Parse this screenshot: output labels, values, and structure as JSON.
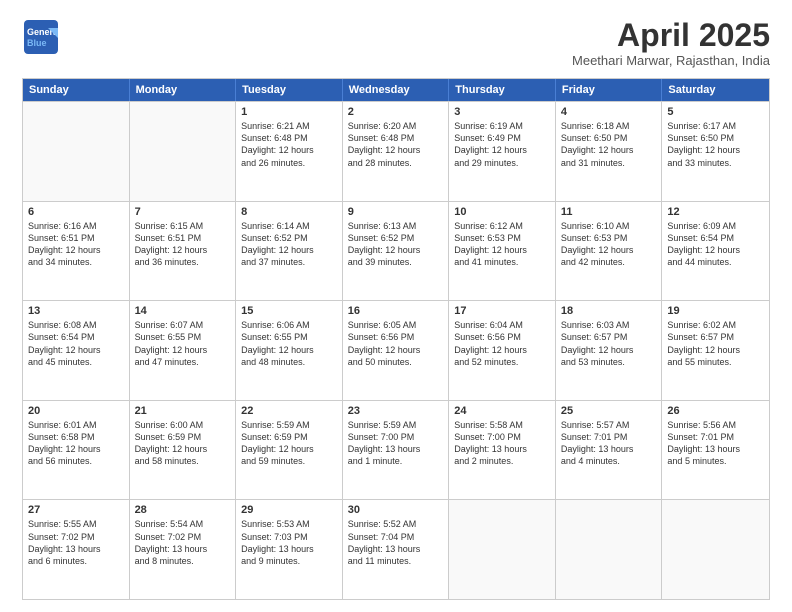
{
  "header": {
    "logo_line1": "General",
    "logo_line2": "Blue",
    "month": "April 2025",
    "location": "Meethari Marwar, Rajasthan, India"
  },
  "days_of_week": [
    "Sunday",
    "Monday",
    "Tuesday",
    "Wednesday",
    "Thursday",
    "Friday",
    "Saturday"
  ],
  "weeks": [
    [
      {
        "day": "",
        "empty": true,
        "lines": []
      },
      {
        "day": "",
        "empty": true,
        "lines": []
      },
      {
        "day": "1",
        "empty": false,
        "lines": [
          "Sunrise: 6:21 AM",
          "Sunset: 6:48 PM",
          "Daylight: 12 hours",
          "and 26 minutes."
        ]
      },
      {
        "day": "2",
        "empty": false,
        "lines": [
          "Sunrise: 6:20 AM",
          "Sunset: 6:48 PM",
          "Daylight: 12 hours",
          "and 28 minutes."
        ]
      },
      {
        "day": "3",
        "empty": false,
        "lines": [
          "Sunrise: 6:19 AM",
          "Sunset: 6:49 PM",
          "Daylight: 12 hours",
          "and 29 minutes."
        ]
      },
      {
        "day": "4",
        "empty": false,
        "lines": [
          "Sunrise: 6:18 AM",
          "Sunset: 6:50 PM",
          "Daylight: 12 hours",
          "and 31 minutes."
        ]
      },
      {
        "day": "5",
        "empty": false,
        "lines": [
          "Sunrise: 6:17 AM",
          "Sunset: 6:50 PM",
          "Daylight: 12 hours",
          "and 33 minutes."
        ]
      }
    ],
    [
      {
        "day": "6",
        "empty": false,
        "lines": [
          "Sunrise: 6:16 AM",
          "Sunset: 6:51 PM",
          "Daylight: 12 hours",
          "and 34 minutes."
        ]
      },
      {
        "day": "7",
        "empty": false,
        "lines": [
          "Sunrise: 6:15 AM",
          "Sunset: 6:51 PM",
          "Daylight: 12 hours",
          "and 36 minutes."
        ]
      },
      {
        "day": "8",
        "empty": false,
        "lines": [
          "Sunrise: 6:14 AM",
          "Sunset: 6:52 PM",
          "Daylight: 12 hours",
          "and 37 minutes."
        ]
      },
      {
        "day": "9",
        "empty": false,
        "lines": [
          "Sunrise: 6:13 AM",
          "Sunset: 6:52 PM",
          "Daylight: 12 hours",
          "and 39 minutes."
        ]
      },
      {
        "day": "10",
        "empty": false,
        "lines": [
          "Sunrise: 6:12 AM",
          "Sunset: 6:53 PM",
          "Daylight: 12 hours",
          "and 41 minutes."
        ]
      },
      {
        "day": "11",
        "empty": false,
        "lines": [
          "Sunrise: 6:10 AM",
          "Sunset: 6:53 PM",
          "Daylight: 12 hours",
          "and 42 minutes."
        ]
      },
      {
        "day": "12",
        "empty": false,
        "lines": [
          "Sunrise: 6:09 AM",
          "Sunset: 6:54 PM",
          "Daylight: 12 hours",
          "and 44 minutes."
        ]
      }
    ],
    [
      {
        "day": "13",
        "empty": false,
        "lines": [
          "Sunrise: 6:08 AM",
          "Sunset: 6:54 PM",
          "Daylight: 12 hours",
          "and 45 minutes."
        ]
      },
      {
        "day": "14",
        "empty": false,
        "lines": [
          "Sunrise: 6:07 AM",
          "Sunset: 6:55 PM",
          "Daylight: 12 hours",
          "and 47 minutes."
        ]
      },
      {
        "day": "15",
        "empty": false,
        "lines": [
          "Sunrise: 6:06 AM",
          "Sunset: 6:55 PM",
          "Daylight: 12 hours",
          "and 48 minutes."
        ]
      },
      {
        "day": "16",
        "empty": false,
        "lines": [
          "Sunrise: 6:05 AM",
          "Sunset: 6:56 PM",
          "Daylight: 12 hours",
          "and 50 minutes."
        ]
      },
      {
        "day": "17",
        "empty": false,
        "lines": [
          "Sunrise: 6:04 AM",
          "Sunset: 6:56 PM",
          "Daylight: 12 hours",
          "and 52 minutes."
        ]
      },
      {
        "day": "18",
        "empty": false,
        "lines": [
          "Sunrise: 6:03 AM",
          "Sunset: 6:57 PM",
          "Daylight: 12 hours",
          "and 53 minutes."
        ]
      },
      {
        "day": "19",
        "empty": false,
        "lines": [
          "Sunrise: 6:02 AM",
          "Sunset: 6:57 PM",
          "Daylight: 12 hours",
          "and 55 minutes."
        ]
      }
    ],
    [
      {
        "day": "20",
        "empty": false,
        "lines": [
          "Sunrise: 6:01 AM",
          "Sunset: 6:58 PM",
          "Daylight: 12 hours",
          "and 56 minutes."
        ]
      },
      {
        "day": "21",
        "empty": false,
        "lines": [
          "Sunrise: 6:00 AM",
          "Sunset: 6:59 PM",
          "Daylight: 12 hours",
          "and 58 minutes."
        ]
      },
      {
        "day": "22",
        "empty": false,
        "lines": [
          "Sunrise: 5:59 AM",
          "Sunset: 6:59 PM",
          "Daylight: 12 hours",
          "and 59 minutes."
        ]
      },
      {
        "day": "23",
        "empty": false,
        "lines": [
          "Sunrise: 5:59 AM",
          "Sunset: 7:00 PM",
          "Daylight: 13 hours",
          "and 1 minute."
        ]
      },
      {
        "day": "24",
        "empty": false,
        "lines": [
          "Sunrise: 5:58 AM",
          "Sunset: 7:00 PM",
          "Daylight: 13 hours",
          "and 2 minutes."
        ]
      },
      {
        "day": "25",
        "empty": false,
        "lines": [
          "Sunrise: 5:57 AM",
          "Sunset: 7:01 PM",
          "Daylight: 13 hours",
          "and 4 minutes."
        ]
      },
      {
        "day": "26",
        "empty": false,
        "lines": [
          "Sunrise: 5:56 AM",
          "Sunset: 7:01 PM",
          "Daylight: 13 hours",
          "and 5 minutes."
        ]
      }
    ],
    [
      {
        "day": "27",
        "empty": false,
        "lines": [
          "Sunrise: 5:55 AM",
          "Sunset: 7:02 PM",
          "Daylight: 13 hours",
          "and 6 minutes."
        ]
      },
      {
        "day": "28",
        "empty": false,
        "lines": [
          "Sunrise: 5:54 AM",
          "Sunset: 7:02 PM",
          "Daylight: 13 hours",
          "and 8 minutes."
        ]
      },
      {
        "day": "29",
        "empty": false,
        "lines": [
          "Sunrise: 5:53 AM",
          "Sunset: 7:03 PM",
          "Daylight: 13 hours",
          "and 9 minutes."
        ]
      },
      {
        "day": "30",
        "empty": false,
        "lines": [
          "Sunrise: 5:52 AM",
          "Sunset: 7:04 PM",
          "Daylight: 13 hours",
          "and 11 minutes."
        ]
      },
      {
        "day": "",
        "empty": true,
        "lines": []
      },
      {
        "day": "",
        "empty": true,
        "lines": []
      },
      {
        "day": "",
        "empty": true,
        "lines": []
      }
    ]
  ]
}
